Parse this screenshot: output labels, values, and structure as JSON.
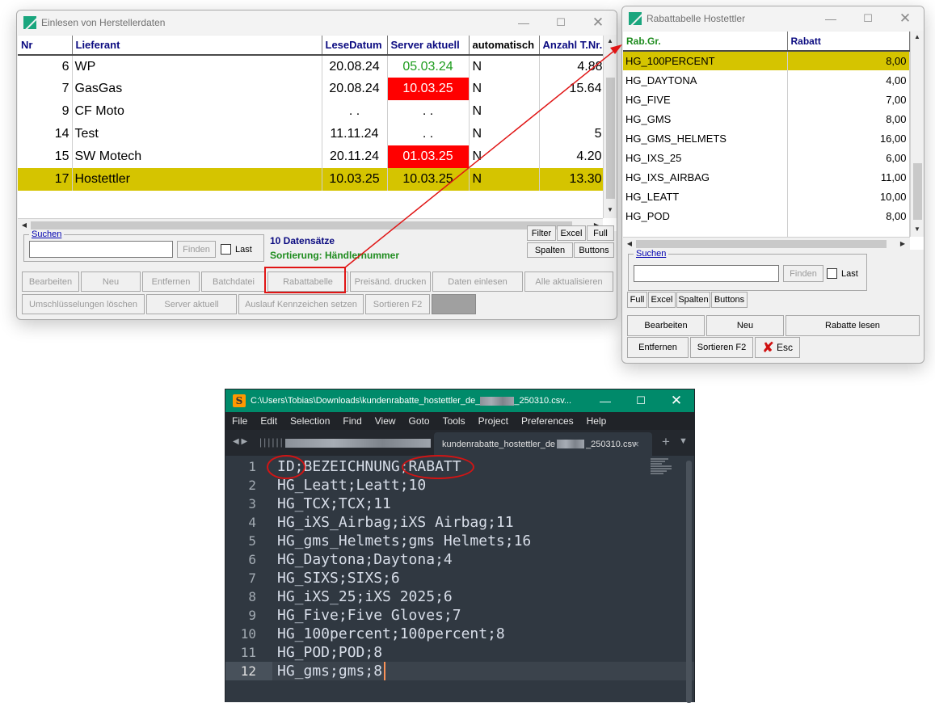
{
  "win1": {
    "title": "Einlesen von Herstellerdaten",
    "columns": [
      "Nr",
      "Lieferant",
      "LeseDatum",
      "Server aktuell",
      "automatisch",
      "Anzahl T.Nr."
    ],
    "rows": [
      {
        "nr": "6",
        "lieferant": "WP",
        "lese": "20.08.24",
        "server": "05.03.24",
        "auto": "N",
        "anzahl": "4.88"
      },
      {
        "nr": "7",
        "lieferant": "GasGas",
        "lese": "20.08.24",
        "server": "10.03.25",
        "auto": "N",
        "anzahl": "15.64"
      },
      {
        "nr": "9",
        "lieferant": "CF Moto",
        "lese": ". .",
        "server": ". .",
        "auto": "N",
        "anzahl": ""
      },
      {
        "nr": "14",
        "lieferant": "Test",
        "lese": "11.11.24",
        "server": ". .",
        "auto": "N",
        "anzahl": "5"
      },
      {
        "nr": "15",
        "lieferant": "SW Motech",
        "lese": "20.11.24",
        "server": "01.03.25",
        "auto": "N",
        "anzahl": "4.20"
      },
      {
        "nr": "17",
        "lieferant": "Hostettler",
        "lese": "10.03.25",
        "server": "10.03.25",
        "auto": "N",
        "anzahl": "13.30"
      }
    ],
    "search_label": "Suchen",
    "find_label": "Finden",
    "last_label": "Last",
    "record_count": "10 Datensätze",
    "sort_label": "Sortierung: Händlernummer",
    "buttons_small": [
      "Filter",
      "Excel",
      "Full",
      "Spalten",
      "Buttons"
    ],
    "buttons_row1": [
      "Bearbeiten",
      "Neu",
      "Entfernen",
      "Batchdatei",
      "Rabattabelle",
      "Preisänd. drucken",
      "Daten einlesen",
      "Alle aktualisieren"
    ],
    "buttons_row2": [
      "Umschlüsselungen löschen",
      "Server aktuell",
      "Auslauf Kennzeichen setzen",
      "Sortieren F2"
    ]
  },
  "win2": {
    "title": "Rabattabelle Hostettler",
    "columns": [
      "Rab.Gr.",
      "Rabatt"
    ],
    "rows": [
      {
        "group": "HG_100PERCENT",
        "rabatt": "8,00"
      },
      {
        "group": "HG_DAYTONA",
        "rabatt": "4,00"
      },
      {
        "group": "HG_FIVE",
        "rabatt": "7,00"
      },
      {
        "group": "HG_GMS",
        "rabatt": "8,00"
      },
      {
        "group": "HG_GMS_HELMETS",
        "rabatt": "16,00"
      },
      {
        "group": "HG_IXS_25",
        "rabatt": "6,00"
      },
      {
        "group": "HG_IXS_AIRBAG",
        "rabatt": "11,00"
      },
      {
        "group": "HG_LEATT",
        "rabatt": "10,00"
      },
      {
        "group": "HG_POD",
        "rabatt": "8,00"
      }
    ],
    "search_label": "Suchen",
    "find_label": "Finden",
    "last_label": "Last",
    "buttons_small": [
      "Full",
      "Excel",
      "Spalten",
      "Buttons"
    ],
    "buttons_row1": [
      "Bearbeiten",
      "Neu",
      "Rabatte lesen"
    ],
    "buttons_row2": [
      "Entfernen",
      "Sortieren F2",
      "Esc"
    ]
  },
  "editor": {
    "title": "C:\\Users\\Tobias\\Downloads\\kundenrabatte_hostettler_de_",
    "title_suffix": "_250310.csv...",
    "menu": [
      "File",
      "Edit",
      "Selection",
      "Find",
      "View",
      "Goto",
      "Tools",
      "Project",
      "Preferences",
      "Help"
    ],
    "tab_name": "kundenrabatte_hostettler_de",
    "tab_suffix": "_250310.csv",
    "tab_close": "×",
    "lines": [
      "ID;BEZEICHNUNG;RABATT",
      "HG_Leatt;Leatt;10",
      "HG_TCX;TCX;11",
      "HG_iXS_Airbag;iXS Airbag;11",
      "HG_gms_Helmets;gms Helmets;16",
      "HG_Daytona;Daytona;4",
      "HG_SIXS;SIXS;6",
      "HG_iXS_25;iXS 2025;6",
      "HG_Five;Five Gloves;7",
      "HG_100percent;100percent;8",
      "HG_POD;POD;8",
      "HG_gms;gms;8"
    ],
    "line_numbers": [
      "1",
      "2",
      "3",
      "4",
      "5",
      "6",
      "7",
      "8",
      "9",
      "10",
      "11",
      "12"
    ]
  },
  "colors": {
    "selection_yellow": "#d5c400",
    "alert_red": "#ff0000",
    "ok_green": "#1e9c1e",
    "header_blue": "#0a0a80",
    "header_green": "#1e8c1e",
    "sublime_bg": "#303841",
    "sublime_titlebar": "#008a6a",
    "annotation_red": "#d01515"
  }
}
